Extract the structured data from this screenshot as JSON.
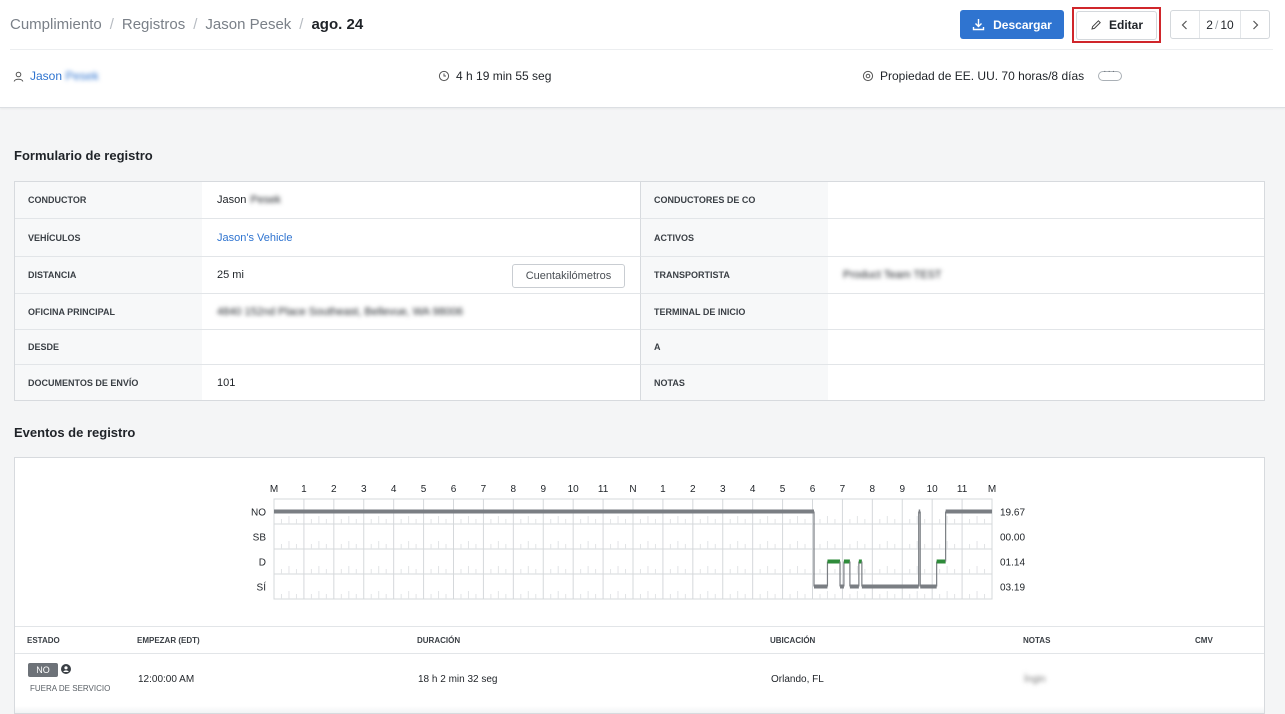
{
  "breadcrumb": {
    "items": [
      "Cumplimiento",
      "Registros",
      "Jason Pesek"
    ],
    "current": "ago. 24"
  },
  "toolbar": {
    "download_label": "Descargar",
    "edit_label": "Editar",
    "pager_current": "2",
    "pager_sep": "/",
    "pager_total": "10"
  },
  "summary": {
    "driver_first": "Jason",
    "driver_last": "Pesek",
    "duration": "4 h 19 min 55 seg",
    "ruleset": "Propiedad de EE. UU. 70 horas/8 días"
  },
  "form": {
    "title": "Formulario de registro",
    "rows": [
      {
        "l1": "CONDUCTOR",
        "v1": "Jason",
        "v1_hidden": "Pesek",
        "l2": "CONDUCTORES DE CO",
        "v2": ""
      },
      {
        "l1": "VEHÍCULOS",
        "v1": "Jason's Vehicle",
        "l2": "ACTIVOS",
        "v2": ""
      },
      {
        "l1": "DISTANCIA",
        "v1": "25 mi",
        "l2": "TRANSPORTISTA",
        "v2": "Product Team TEST"
      },
      {
        "l1": "OFICINA PRINCIPAL",
        "v1": "4840 152nd Place Southeast, Bellevue, WA 98006",
        "l2": "TERMINAL DE INICIO",
        "v2": ""
      },
      {
        "l1": "DESDE",
        "v1": "",
        "l2": "A",
        "v2": ""
      },
      {
        "l1": "DOCUMENTOS DE ENVÍO",
        "v1": "101",
        "l2": "NOTAS",
        "v2": ""
      }
    ],
    "odometer_label": "Cuentakilómetros"
  },
  "events": {
    "title": "Eventos de registro",
    "hour_labels": [
      "M",
      "1",
      "2",
      "3",
      "4",
      "5",
      "6",
      "7",
      "8",
      "9",
      "10",
      "11",
      "N",
      "1",
      "2",
      "3",
      "4",
      "5",
      "6",
      "7",
      "8",
      "9",
      "10",
      "11",
      "M"
    ],
    "status_labels": [
      "NO",
      "SB",
      "D",
      "SÍ"
    ],
    "totals": [
      "19.67",
      "00.00",
      "01.14",
      "03.19"
    ],
    "colors": {
      "duty_line": "#7a7e83",
      "driving": "#2e8b3a",
      "grid": "#d5d8db"
    },
    "timeline": [
      {
        "status": 0,
        "start": 0,
        "end": 18.05
      },
      {
        "status": 3,
        "start": 18.05,
        "end": 18.5
      },
      {
        "status": 2,
        "start": 18.5,
        "end": 18.92
      },
      {
        "status": 3,
        "start": 18.92,
        "end": 19.05
      },
      {
        "status": 2,
        "start": 19.05,
        "end": 19.25
      },
      {
        "status": 3,
        "start": 19.25,
        "end": 19.55
      },
      {
        "status": 2,
        "start": 19.55,
        "end": 19.65
      },
      {
        "status": 3,
        "start": 19.65,
        "end": 21.55
      },
      {
        "status": 0,
        "start": 21.55,
        "end": 21.6
      },
      {
        "status": 3,
        "start": 21.6,
        "end": 22.15
      },
      {
        "status": 2,
        "start": 22.15,
        "end": 22.45
      },
      {
        "status": 0,
        "start": 22.45,
        "end": 24
      }
    ],
    "columns": [
      "ESTADO",
      "EMPEZAR (EDT)",
      "DURACIÓN",
      "UBICACIÓN",
      "NOTAS",
      "CMV"
    ],
    "rows": [
      {
        "status_badge": "NO",
        "status_text": "FUERA DE SERVICIO",
        "start": "12:00:00 AM",
        "duration": "18 h 2 min 32 seg",
        "location": "Orlando, FL",
        "notes": "Íngin",
        "cmv": ""
      }
    ]
  }
}
